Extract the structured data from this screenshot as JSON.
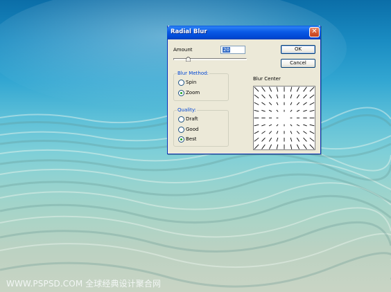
{
  "dialog": {
    "title": "Radial Blur",
    "amount_label": "Amount",
    "amount_value": "20",
    "amount_level": 20,
    "amount_max": 100,
    "ok_label": "OK",
    "cancel_label": "Cancel",
    "blur_method": {
      "title": "Blur Method:",
      "options": [
        "Spin",
        "Zoom"
      ],
      "selected": "Zoom"
    },
    "quality": {
      "title": "Quality:",
      "options": [
        "Draft",
        "Good",
        "Best"
      ],
      "selected": "Best"
    },
    "blur_center_label": "Blur Center"
  },
  "watermark": "WWW.PSPSD.COM 全球经典设计聚合网",
  "colors": {
    "titlebar": "#0a5ae0",
    "dialog_bg": "#ece9d8",
    "group_title": "#0046d5",
    "radio_dot": "#21a121",
    "close_button": "#d2542e"
  },
  "icons": {
    "close": "close-icon",
    "slider_thumb": "slider-thumb-icon"
  }
}
